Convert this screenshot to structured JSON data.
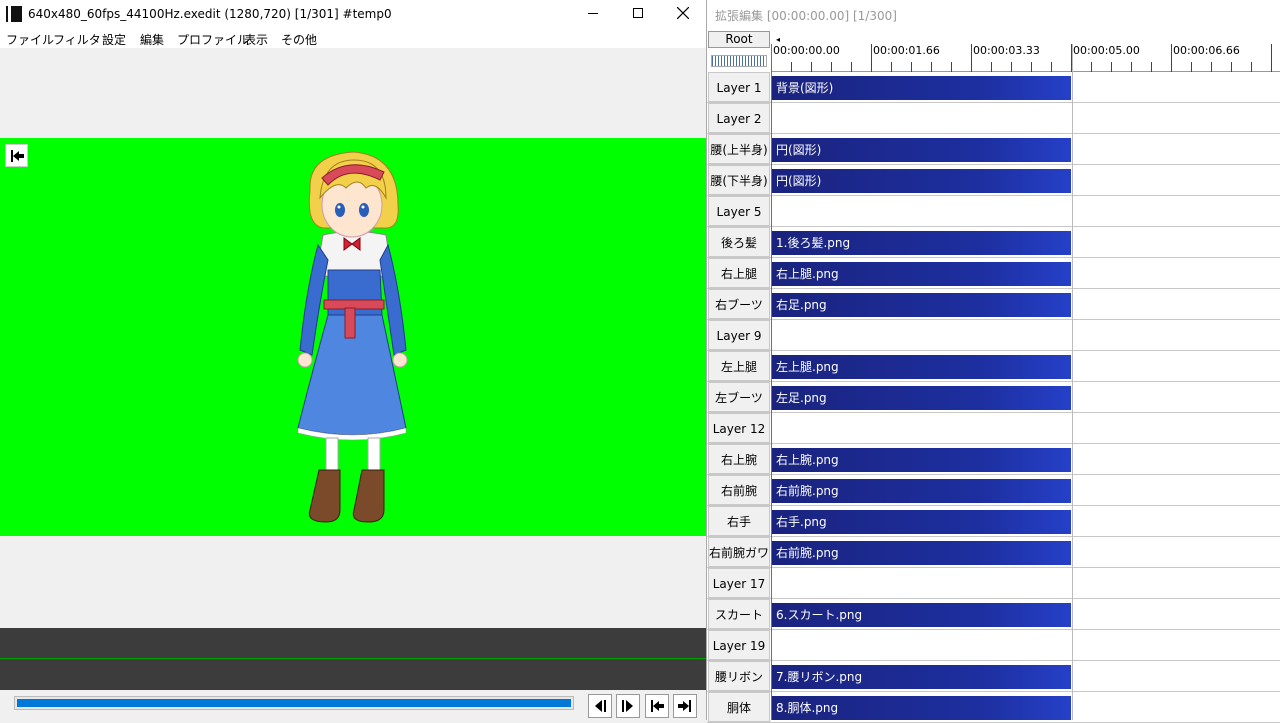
{
  "main": {
    "title": "640x480_60fps_44100Hz.exedit (1280,720)  [1/301]  #temp0",
    "menu": [
      "ファイル",
      "フィルタ",
      "設定",
      "編集",
      "プロファイル",
      "表示",
      "その他"
    ],
    "window_buttons": {
      "minimize": "minimize-icon",
      "maximize": "maximize-icon",
      "close": "close-icon"
    },
    "preview_bg_color": "#00ff00",
    "seek_progress": 0.0033
  },
  "timeline": {
    "title": "拡張編集 [00:00:00.00] [1/300]",
    "root_label": "Root",
    "ruler_labels": [
      "00:00:00.00",
      "00:00:01.66",
      "00:00:03.33",
      "00:00:05.00",
      "00:00:06.66"
    ],
    "layers": [
      {
        "label": "Layer  1",
        "clip": "背景(図形)"
      },
      {
        "label": "Layer  2",
        "clip": ""
      },
      {
        "label": "腰(上半身)",
        "clip": "円(図形)"
      },
      {
        "label": "腰(下半身)",
        "clip": "円(図形)"
      },
      {
        "label": "Layer  5",
        "clip": ""
      },
      {
        "label": "後ろ髪",
        "clip": "1.後ろ髪.png"
      },
      {
        "label": "右上腿",
        "clip": "右上腿.png"
      },
      {
        "label": "右ブーツ",
        "clip": "右足.png"
      },
      {
        "label": "Layer  9",
        "clip": ""
      },
      {
        "label": "左上腿",
        "clip": "左上腿.png"
      },
      {
        "label": "左ブーツ",
        "clip": "左足.png"
      },
      {
        "label": "Layer 12",
        "clip": ""
      },
      {
        "label": "右上腕",
        "clip": "右上腕.png"
      },
      {
        "label": "右前腕",
        "clip": "右前腕.png"
      },
      {
        "label": "右手",
        "clip": "右手.png"
      },
      {
        "label": "右前腕ガワ",
        "clip": "右前腕.png"
      },
      {
        "label": "Layer 17",
        "clip": ""
      },
      {
        "label": "スカート",
        "clip": "6.スカート.png"
      },
      {
        "label": "Layer 19",
        "clip": ""
      },
      {
        "label": "腰リボン",
        "clip": "7.腰リボン.png"
      },
      {
        "label": "胴体",
        "clip": "8.胴体.png"
      }
    ],
    "clip_color": "#1a237e"
  }
}
